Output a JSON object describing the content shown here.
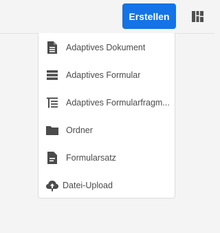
{
  "header": {
    "create_label": "Erstellen",
    "accent_color": "#1473e6",
    "view_switch_icon": "column-view-icon"
  },
  "menu": {
    "items": [
      {
        "label": "Adaptives Dokument",
        "icon": "document-icon"
      },
      {
        "label": "Adaptives Formular",
        "icon": "form-icon"
      },
      {
        "label": "Adaptives Formularfragm...",
        "icon": "form-fragment-icon"
      },
      {
        "label": "Ordner",
        "icon": "folder-icon"
      },
      {
        "label": "Formularsatz",
        "icon": "form-set-icon"
      },
      {
        "label": "Datei-Upload",
        "icon": "cloud-upload-icon"
      }
    ]
  }
}
